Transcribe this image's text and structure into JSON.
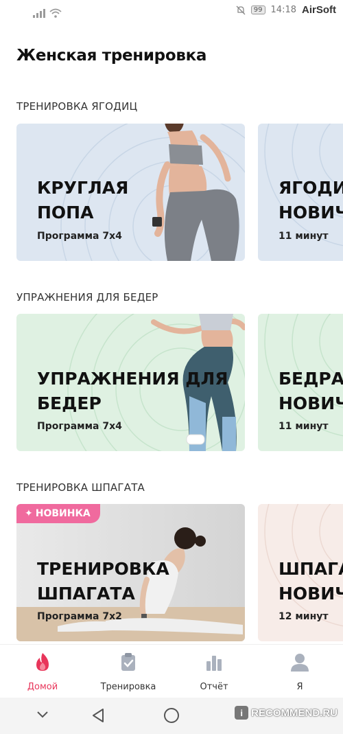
{
  "status": {
    "battery": "99",
    "time": "14:18",
    "brand": "AirSoft"
  },
  "page": {
    "title": "Женская тренировка"
  },
  "sections": [
    {
      "title": "ТРЕНИРОВКА ЯГОДИЦ",
      "cards": [
        {
          "title_line1": "КРУГЛАЯ",
          "title_line2": "ПОПА",
          "subtitle": "Программа 7x4"
        },
        {
          "title_line1": "ЯГОДИЦ",
          "title_line2": "НОВИЧ",
          "subtitle": "11 минут"
        }
      ]
    },
    {
      "title": "УПРАЖНЕНИЯ ДЛЯ БЕДЕР",
      "cards": [
        {
          "title_line1": "УПРАЖНЕНИЯ ДЛЯ",
          "title_line2": "БЕДЕР",
          "subtitle": "Программа 7x4"
        },
        {
          "title_line1": "БЕДРА",
          "title_line2": "НОВИЧ",
          "subtitle": "11 минут"
        }
      ]
    },
    {
      "title": "ТРЕНИРОВКА ШПАГАТА",
      "cards": [
        {
          "badge": "НОВИНКА",
          "title_line1": "ТРЕНИРОВКА",
          "title_line2": "ШПАГАТА",
          "subtitle": "Программа 7x2"
        },
        {
          "title_line1": "ШПАГАТ",
          "title_line2": "НОВИЧ",
          "subtitle": "12 минут"
        }
      ]
    }
  ],
  "nav": [
    {
      "label": "Домой",
      "icon": "flame-icon"
    },
    {
      "label": "Тренировка",
      "icon": "clipboard-icon"
    },
    {
      "label": "Отчёт",
      "icon": "bar-chart-icon"
    },
    {
      "label": "Я",
      "icon": "person-icon"
    }
  ],
  "watermark": {
    "text": "RECOMMEND.RU"
  },
  "colors": {
    "accent": "#e8355a",
    "card_blue": "#dde6f1",
    "card_green": "#dff1e2",
    "card_pink": "#f7ece8",
    "badge": "#f06a9e"
  }
}
